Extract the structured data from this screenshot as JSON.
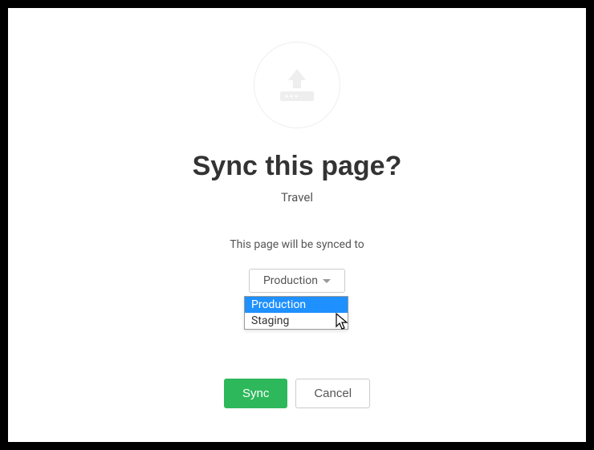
{
  "dialog": {
    "title": "Sync this page?",
    "page_name": "Travel",
    "description": "This page will be synced to",
    "dropdown": {
      "selected": "Production",
      "options": [
        "Production",
        "Staging"
      ],
      "highlighted_index": 0
    },
    "buttons": {
      "primary": "Sync",
      "secondary": "Cancel"
    }
  },
  "icons": {
    "hero": "upload-icon",
    "dropdown_caret": "caret-down-icon"
  },
  "colors": {
    "primary_button": "#2eb85c",
    "highlight": "#1e90ff"
  }
}
